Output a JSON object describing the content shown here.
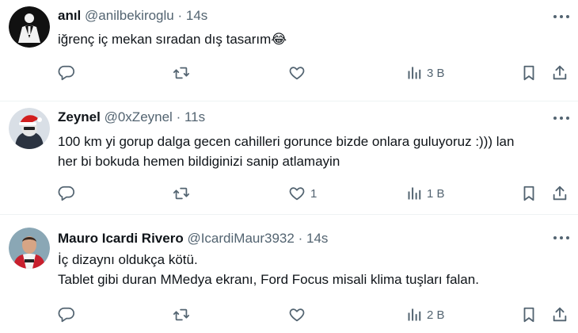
{
  "tweets": [
    {
      "name": "anıl",
      "handle": "@anilbekiroglu",
      "separator": "·",
      "time": "14s",
      "lines": [
        "iğrenç iç mekan sıradan dış tasarım😂"
      ],
      "likes": "",
      "views": "3 B",
      "avatar": "avatar-suit-black"
    },
    {
      "name": "Zeynel",
      "handle": "@0xZeynel",
      "separator": "·",
      "time": "11s",
      "lines": [
        "100 km yi gorup dalga gecen cahilleri gorunce bizde onlara guluyoruz :))) lan",
        "her bi bokuda hemen bildiginizi sanip atlamayin"
      ],
      "likes": "1",
      "views": "1 B",
      "avatar": "avatar-santa-hat"
    },
    {
      "name": "Mauro Icardi Rivero",
      "handle": "@IcardiMaur3932",
      "separator": "·",
      "time": "14s",
      "lines": [
        "İç dizaynı oldukça kötü.",
        "Tablet gibi duran MMedya ekranı, Ford Focus misali klima tuşları falan."
      ],
      "likes": "",
      "views": "2 B",
      "avatar": "avatar-footballer-photo"
    }
  ],
  "colors": {
    "text": "#0f1419",
    "secondary": "#536471",
    "divider": "#eff3f4"
  },
  "icons": [
    "more-icon",
    "reply-icon",
    "retweet-icon",
    "like-icon",
    "views-icon",
    "bookmark-icon",
    "share-icon"
  ]
}
